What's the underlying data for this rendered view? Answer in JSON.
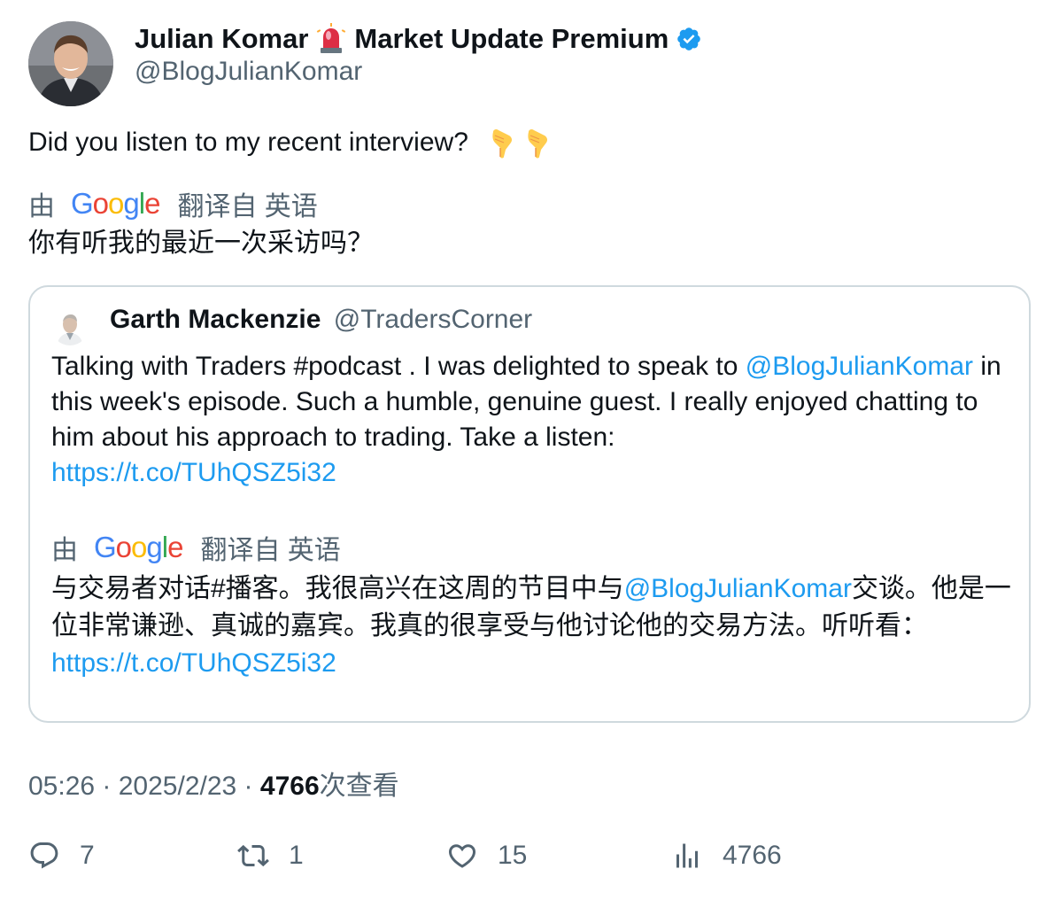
{
  "author": {
    "display_name": "Julian Komar",
    "display_name_suffix": "Market Update Premium",
    "handle": "@BlogJulianKomar",
    "icons": [
      "siren-icon",
      "verified-badge-icon"
    ]
  },
  "tweet": {
    "text": "Did you listen to my recent interview?",
    "translation": {
      "by_label": "由",
      "google_letters": [
        "G",
        "o",
        "o",
        "g",
        "l",
        "e"
      ],
      "source_label": "翻译自 英语",
      "text": "你有听我的最近一次采访吗？"
    }
  },
  "quoted_tweet": {
    "author_name": "Garth Mackenzie",
    "author_handle": "@TradersCorner",
    "text_part1": "Talking with Traders #podcast . I was delighted to speak to ",
    "mention": "@BlogJulianKomar",
    "text_part2": " in this week's episode. Such a humble, genuine guest. I really enjoyed chatting to him about his approach to trading. Take a listen:",
    "link": "https://t.co/TUhQSZ5i32",
    "translation": {
      "by_label": "由",
      "source_label": "翻译自 英语",
      "text_part1": "与交易者对话#播客。我很高兴在这周的节目中与",
      "mention": "@BlogJulianKomar",
      "text_part2": "交谈。他是一位非常谦逊、真诚的嘉宾。我真的很享受与他讨论他的交易方法。听听看：",
      "link": "https://t.co/TUhQSZ5i32"
    }
  },
  "meta": {
    "time": "05:26",
    "separator": " · ",
    "date": "2025/2/23",
    "views_count": "4766",
    "views_label": "次查看"
  },
  "actions": {
    "replies": "7",
    "reposts": "1",
    "likes": "15",
    "views": "4766"
  },
  "colors": {
    "link": "#1d9bf0",
    "secondary_text": "#536471",
    "border": "#cfd9de"
  }
}
